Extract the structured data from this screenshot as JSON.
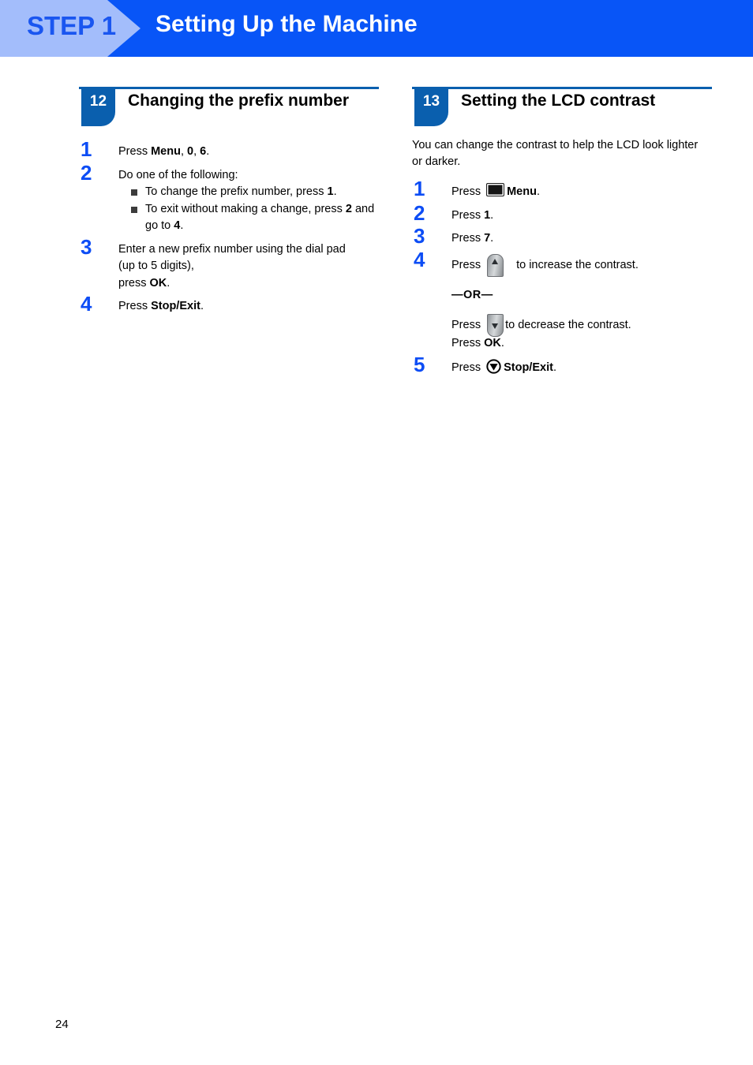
{
  "banner": {
    "step_label": "STEP 1",
    "title": "Setting Up the Machine",
    "bg_color": "#0855f7",
    "chevron_color": "#a3bdfb",
    "step_text_color": "#1a56f0"
  },
  "sections": [
    {
      "number": "12",
      "title": "Changing the prefix number",
      "intro": "",
      "steps": [
        {
          "num": "1",
          "lines": [
            {
              "parts": [
                {
                  "t": "Press ",
                  "b": false
                },
                {
                  "t": "Menu",
                  "b": true
                },
                {
                  "t": ", ",
                  "b": false
                },
                {
                  "t": "0",
                  "b": true
                },
                {
                  "t": ", ",
                  "b": false
                },
                {
                  "t": "6",
                  "b": true
                },
                {
                  "t": ".",
                  "b": false
                }
              ]
            }
          ]
        },
        {
          "num": "2",
          "lines": [
            {
              "parts": [
                {
                  "t": "Do one of the following:",
                  "b": false
                }
              ]
            }
          ],
          "bullets": [
            {
              "parts": [
                {
                  "t": "To change the prefix number, press ",
                  "b": false
                },
                {
                  "t": "1",
                  "b": true
                },
                {
                  "t": ".",
                  "b": false
                }
              ]
            },
            {
              "parts": [
                {
                  "t": "To exit without making a change, press ",
                  "b": false
                },
                {
                  "t": "2",
                  "b": true
                },
                {
                  "t": " and go to ",
                  "b": false
                },
                {
                  "t": "4",
                  "b": true
                },
                {
                  "t": ".",
                  "b": false
                }
              ]
            }
          ]
        },
        {
          "num": "3",
          "lines": [
            {
              "parts": [
                {
                  "t": "Enter a new prefix number using the dial pad",
                  "b": false
                }
              ]
            },
            {
              "parts": [
                {
                  "t": "(up to 5 digits),",
                  "b": false
                }
              ]
            },
            {
              "parts": [
                {
                  "t": "press ",
                  "b": false
                },
                {
                  "t": "OK",
                  "b": true
                },
                {
                  "t": ".",
                  "b": false
                }
              ]
            }
          ]
        },
        {
          "num": "4",
          "lines": [
            {
              "parts": [
                {
                  "t": "Press ",
                  "b": false
                },
                {
                  "t": "Stop/Exit",
                  "b": true
                },
                {
                  "t": ".",
                  "b": false
                }
              ]
            }
          ]
        }
      ]
    },
    {
      "number": "13",
      "title": "Setting the LCD contrast",
      "intro": "You can change the contrast to help the LCD look lighter or darker.",
      "steps": [
        {
          "num": "1",
          "lines": [
            {
              "parts": [
                {
                  "t": "Press ",
                  "b": false
                },
                {
                  "icon": "menu-button-icon"
                },
                {
                  "t": "Menu",
                  "b": true
                },
                {
                  "t": ".",
                  "b": false
                }
              ]
            }
          ]
        },
        {
          "num": "2",
          "lines": [
            {
              "parts": [
                {
                  "t": "Press ",
                  "b": false
                },
                {
                  "t": "1",
                  "b": true
                },
                {
                  "t": ".",
                  "b": false
                }
              ]
            }
          ]
        },
        {
          "num": "3",
          "lines": [
            {
              "parts": [
                {
                  "t": "Press ",
                  "b": false
                },
                {
                  "t": "7",
                  "b": true
                },
                {
                  "t": ".",
                  "b": false
                }
              ]
            }
          ]
        },
        {
          "num": "4",
          "lines": [
            {
              "parts": [
                {
                  "t": "Press ",
                  "b": false
                },
                {
                  "icon": "arrow-up-key-icon"
                },
                {
                  "spacer": true
                },
                {
                  "t": "to increase the contrast.",
                  "b": false
                }
              ]
            }
          ],
          "or_label": "—OR—",
          "or_lines": [
            {
              "parts": [
                {
                  "t": "Press ",
                  "b": false
                },
                {
                  "icon": "arrow-down-key-icon"
                },
                {
                  "t": "to decrease the contrast.",
                  "b": false
                }
              ]
            },
            {
              "parts": [
                {
                  "t": "Press ",
                  "b": false
                },
                {
                  "t": "OK",
                  "b": true
                },
                {
                  "t": ".",
                  "b": false
                }
              ]
            }
          ]
        },
        {
          "num": "5",
          "lines": [
            {
              "parts": [
                {
                  "t": "Press ",
                  "b": false
                },
                {
                  "icon": "stop-exit-icon"
                },
                {
                  "t": "Stop/Exit",
                  "b": true
                },
                {
                  "t": ".",
                  "b": false
                }
              ]
            }
          ]
        }
      ]
    }
  ],
  "footer": {
    "page_number": "24"
  }
}
